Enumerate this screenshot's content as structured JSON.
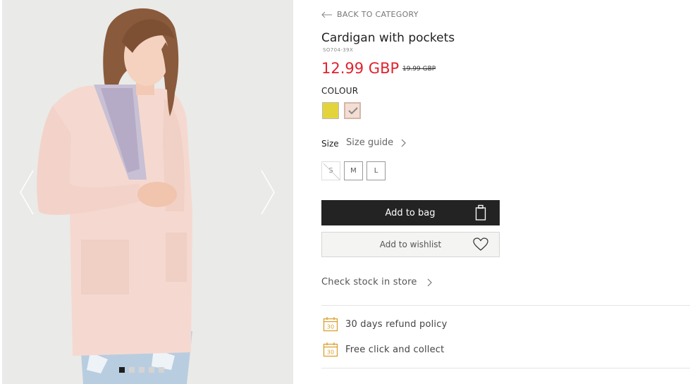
{
  "navigation": {
    "back_label": "BACK TO CATEGORY"
  },
  "product": {
    "name": "Cardigan with pockets",
    "sku": "SO704-39X",
    "price": "12.99 GBP",
    "old_price": "19.99 GBP"
  },
  "colour": {
    "label": "COLOUR",
    "swatches": [
      {
        "name": "yellow",
        "hex": "#e3d43c",
        "selected": false
      },
      {
        "name": "pink",
        "hex": "#f4ddd2",
        "selected": true
      }
    ]
  },
  "size": {
    "label": "Size",
    "guide_label": "Size guide",
    "options": [
      {
        "label": "S",
        "available": false
      },
      {
        "label": "M",
        "available": true
      },
      {
        "label": "L",
        "available": true
      }
    ]
  },
  "actions": {
    "add_to_bag": "Add to bag",
    "add_to_wishlist": "Add to wishlist",
    "check_stock": "Check stock in store"
  },
  "benefits": [
    {
      "label": "30 days refund policy",
      "icon": "calendar-30-icon",
      "icon_text": "30"
    },
    {
      "label": "Free click and collect",
      "icon": "calendar-30-icon",
      "icon_text": "30"
    }
  ],
  "gallery": {
    "image_count": 5,
    "active_index": 0
  },
  "colors": {
    "accent_price": "#e0232f",
    "button_dark": "#232323",
    "benefit_icon": "#d9a030"
  }
}
